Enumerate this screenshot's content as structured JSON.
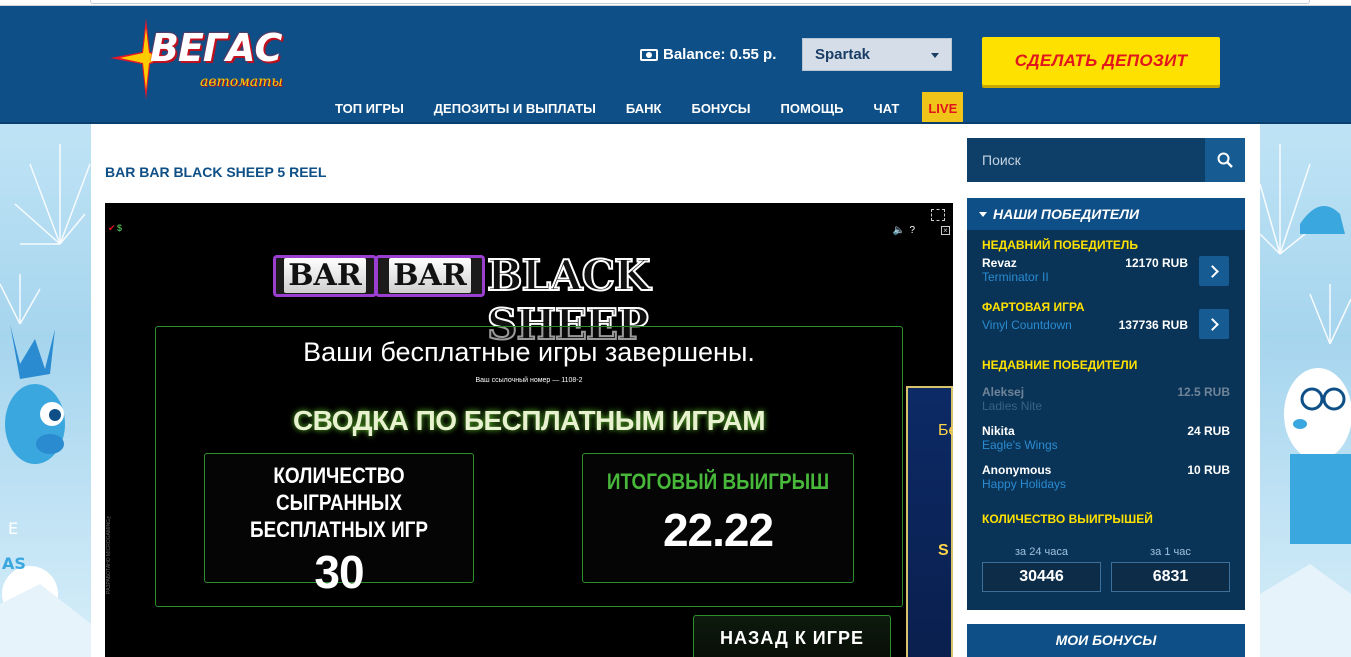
{
  "header": {
    "logo": {
      "text": "ВЕГАС",
      "subtext": "автоматы"
    },
    "balance": {
      "label": "Balance: 0.55 р."
    },
    "account": {
      "selected": "Spartak"
    },
    "deposit_button": "СДЕЛАТЬ ДЕПОЗИТ",
    "nav": [
      {
        "label": "ТОП ИГРЫ"
      },
      {
        "label": "ДЕПОЗИТЫ И ВЫПЛАТЫ"
      },
      {
        "label": "БАНК"
      },
      {
        "label": "БОНУСЫ"
      },
      {
        "label": "ПОМОЩЬ"
      },
      {
        "label": "ЧАТ"
      },
      {
        "label": "LIVE"
      }
    ]
  },
  "main": {
    "title": "BAR BAR BLACK SHEEP 5 REEL",
    "game": {
      "logo_bar1": "BAR",
      "logo_bar2": "BAR",
      "logo_main": "BLACK SHEEP",
      "finished_text": "Ваши  бесплатные игры завершены.",
      "ref_text": "Ваш ссылочный номер — 1108-2",
      "summary_title": "СВОДКА ПО БЕСПЛАТНЫМ ИГРАМ",
      "played_label": "КОЛИЧЕСТВО СЫГРАННЫХ БЕСПЛАТНЫХ ИГР",
      "played_value": "30",
      "win_label": "ИТОГОВЫЙ ВЫИГРЫШ",
      "win_value": "22.22",
      "back_label": "НАЗАД К ИГРЕ",
      "side_card_t1": "Бе",
      "side_card_t2": "S",
      "developer": "РАЗРАБОТАНО MICROGAMING™",
      "help": "?"
    }
  },
  "sidebar": {
    "search": {
      "placeholder": "Поиск"
    },
    "winners": {
      "title": "НАШИ ПОБЕДИТЕЛИ",
      "recent_title": "НЕДАВНИЙ ПОБЕДИТЕЛЬ",
      "recent": {
        "name": "Revaz",
        "game": "Terminator II",
        "amount": "12170 RUB"
      },
      "lucky_title": "ФАРТОВАЯ ИГРА",
      "lucky": {
        "game": "Vinyl Countdown",
        "amount": "137736 RUB"
      },
      "recents_title": "НЕДАВНИЕ ПОБЕДИТЕЛИ",
      "list": [
        {
          "name": "Aleksej",
          "game": "Ladies Nite",
          "amount": "12.5 RUB"
        },
        {
          "name": "Nikita",
          "game": "Eagle's Wings",
          "amount": "24 RUB"
        },
        {
          "name": "Anonymous",
          "game": "Happy Holidays",
          "amount": "10 RUB"
        }
      ],
      "count_title": "КОЛИЧЕСТВО ВЫИГРЫШЕЙ",
      "count_24h_label": "за 24 часа",
      "count_24h": "30446",
      "count_1h_label": "за 1 час",
      "count_1h": "6831"
    },
    "bonuses": "МОИ БОНУСЫ"
  },
  "colors": {
    "header_bg": "#0d4f86",
    "deposit_bg": "#ffe100",
    "deposit_text": "#e2141e",
    "winner_section": "#ffe100",
    "game_link": "#2a8bd0"
  }
}
